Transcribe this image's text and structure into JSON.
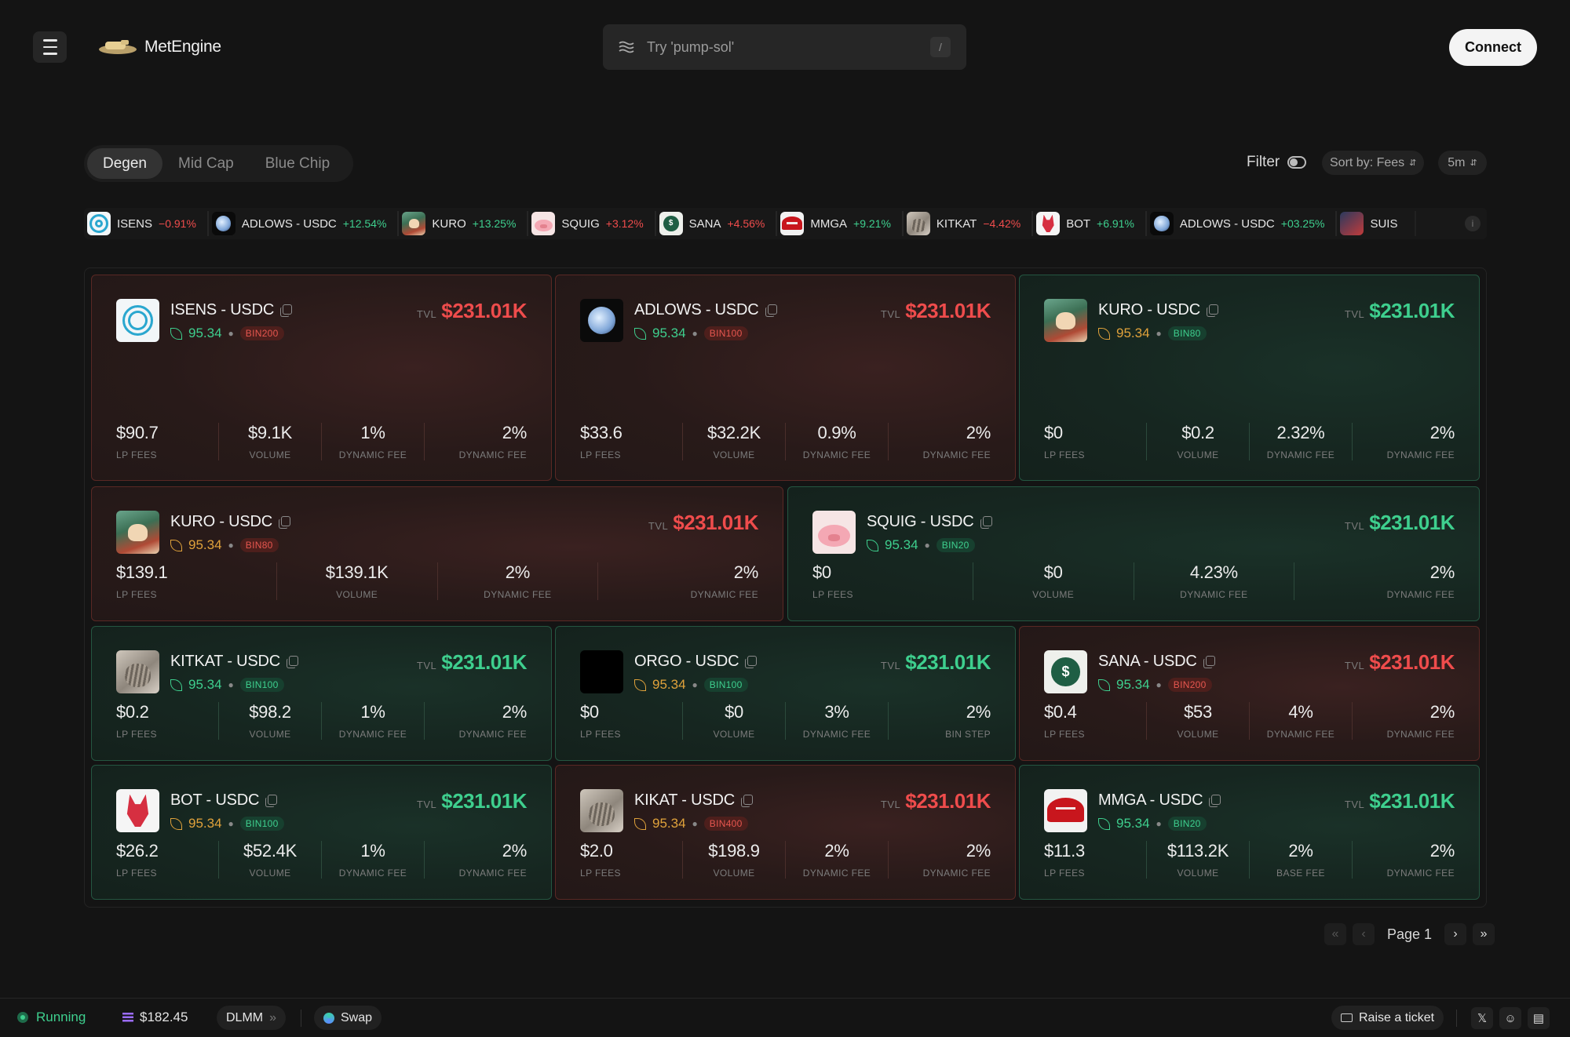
{
  "header": {
    "logo_text": "MetEngine",
    "search_placeholder": "Try 'pump-sol'",
    "search_shortcut": "/",
    "connect_label": "Connect"
  },
  "tabs": [
    {
      "label": "Degen",
      "active": true
    },
    {
      "label": "Mid Cap",
      "active": false
    },
    {
      "label": "Blue Chip",
      "active": false
    }
  ],
  "controls": {
    "filter_label": "Filter",
    "sort_label": "Sort by: Fees",
    "timeframe": "5m"
  },
  "ticker": [
    {
      "name": "ISENS",
      "change": "−0.91%",
      "dir": "down",
      "icon": "isens"
    },
    {
      "name": "ADLOWS - USDC",
      "change": "+12.54%",
      "dir": "up",
      "icon": "adlows"
    },
    {
      "name": "KURO",
      "change": "+13.25%",
      "dir": "up",
      "icon": "kuro"
    },
    {
      "name": "SQUIG",
      "change": "+3.12%",
      "dir": "down",
      "icon": "squig"
    },
    {
      "name": "SANA",
      "change": "+4.56%",
      "dir": "down",
      "icon": "sana"
    },
    {
      "name": "MMGA",
      "change": "+9.21%",
      "dir": "up",
      "icon": "mmga"
    },
    {
      "name": "KITKAT",
      "change": "−4.42%",
      "dir": "down",
      "icon": "kitkat"
    },
    {
      "name": "BOT",
      "change": "+6.91%",
      "dir": "up",
      "icon": "bot"
    },
    {
      "name": "ADLOWS - USDC",
      "change": "+03.25%",
      "dir": "up",
      "icon": "adlows"
    },
    {
      "name": "SUIS",
      "change": "",
      "dir": "up",
      "icon": "suis"
    }
  ],
  "tvl_label": "TVL",
  "cards": [
    {
      "pair": "ISENS - USDC",
      "icon": "isens",
      "theme": "red",
      "score": "95.34",
      "score_color": "green",
      "bin": "BIN200",
      "tvl": "$231.01K",
      "stats": [
        {
          "value": "$90.7",
          "label": "LP FEES"
        },
        {
          "value": "$9.1K",
          "label": "VOLUME"
        },
        {
          "value": "1%",
          "label": "DYNAMIC FEE"
        },
        {
          "value": "2%",
          "label": "DYNAMIC FEE"
        }
      ]
    },
    {
      "pair": "ADLOWS - USDC",
      "icon": "adlows",
      "theme": "red",
      "score": "95.34",
      "score_color": "green",
      "bin": "BIN100",
      "tvl": "$231.01K",
      "stats": [
        {
          "value": "$33.6",
          "label": "LP FEES"
        },
        {
          "value": "$32.2K",
          "label": "VOLUME"
        },
        {
          "value": "0.9%",
          "label": "DYNAMIC FEE"
        },
        {
          "value": "2%",
          "label": "DYNAMIC FEE"
        }
      ]
    },
    {
      "pair": "KURO - USDC",
      "icon": "kuro",
      "theme": "green",
      "score": "95.34",
      "score_color": "orange",
      "bin": "BIN80",
      "tvl": "$231.01K",
      "stats": [
        {
          "value": "$0",
          "label": "LP FEES"
        },
        {
          "value": "$0.2",
          "label": "VOLUME"
        },
        {
          "value": "2.32%",
          "label": "DYNAMIC FEE"
        },
        {
          "value": "2%",
          "label": "DYNAMIC FEE"
        }
      ]
    },
    {
      "pair": "KURO - USDC",
      "icon": "kuro",
      "theme": "red",
      "score": "95.34",
      "score_color": "orange",
      "bin": "BIN80",
      "tvl": "$231.01K",
      "stats": [
        {
          "value": "$139.1",
          "label": "LP FEES"
        },
        {
          "value": "$139.1K",
          "label": "VOLUME"
        },
        {
          "value": "2%",
          "label": "DYNAMIC FEE"
        },
        {
          "value": "2%",
          "label": "DYNAMIC FEE"
        }
      ]
    },
    {
      "pair": "SQUIG - USDC",
      "icon": "squig",
      "theme": "green",
      "score": "95.34",
      "score_color": "green",
      "bin": "BIN20",
      "tvl": "$231.01K",
      "stats": [
        {
          "value": "$0",
          "label": "LP FEES"
        },
        {
          "value": "$0",
          "label": "VOLUME"
        },
        {
          "value": "4.23%",
          "label": "DYNAMIC FEE"
        },
        {
          "value": "2%",
          "label": "DYNAMIC FEE"
        }
      ]
    },
    {
      "pair": "KITKAT - USDC",
      "icon": "kitkat",
      "theme": "green",
      "score": "95.34",
      "score_color": "green",
      "bin": "BIN100",
      "tvl": "$231.01K",
      "stats": [
        {
          "value": "$0.2",
          "label": "LP FEES"
        },
        {
          "value": "$98.2",
          "label": "VOLUME"
        },
        {
          "value": "1%",
          "label": "DYNAMIC FEE"
        },
        {
          "value": "2%",
          "label": "DYNAMIC FEE"
        }
      ]
    },
    {
      "pair": "ORGO - USDC",
      "icon": "orgo",
      "theme": "green",
      "score": "95.34",
      "score_color": "orange",
      "bin": "BIN100",
      "tvl": "$231.01K",
      "stats": [
        {
          "value": "$0",
          "label": "LP FEES"
        },
        {
          "value": "$0",
          "label": "VOLUME"
        },
        {
          "value": "3%",
          "label": "DYNAMIC FEE"
        },
        {
          "value": "2%",
          "label": "BIN STEP"
        }
      ]
    },
    {
      "pair": "SANA - USDC",
      "icon": "sana",
      "theme": "red",
      "score": "95.34",
      "score_color": "green",
      "bin": "BIN200",
      "tvl": "$231.01K",
      "stats": [
        {
          "value": "$0.4",
          "label": "LP FEES"
        },
        {
          "value": "$53",
          "label": "VOLUME"
        },
        {
          "value": "4%",
          "label": "DYNAMIC FEE"
        },
        {
          "value": "2%",
          "label": "DYNAMIC FEE"
        }
      ]
    },
    {
      "pair": "BOT - USDC",
      "icon": "bot",
      "theme": "green",
      "score": "95.34",
      "score_color": "orange",
      "bin": "BIN100",
      "tvl": "$231.01K",
      "stats": [
        {
          "value": "$26.2",
          "label": "LP FEES"
        },
        {
          "value": "$52.4K",
          "label": "VOLUME"
        },
        {
          "value": "1%",
          "label": "DYNAMIC FEE"
        },
        {
          "value": "2%",
          "label": "DYNAMIC FEE"
        }
      ]
    },
    {
      "pair": "KIKAT - USDC",
      "icon": "kitkat",
      "theme": "red",
      "score": "95.34",
      "score_color": "orange",
      "bin": "BIN400",
      "tvl": "$231.01K",
      "stats": [
        {
          "value": "$2.0",
          "label": "LP FEES"
        },
        {
          "value": "$198.9",
          "label": "VOLUME"
        },
        {
          "value": "2%",
          "label": "DYNAMIC FEE"
        },
        {
          "value": "2%",
          "label": "DYNAMIC FEE"
        }
      ]
    },
    {
      "pair": "MMGA - USDC",
      "icon": "mmga",
      "theme": "green",
      "score": "95.34",
      "score_color": "green",
      "bin": "BIN20",
      "tvl": "$231.01K",
      "stats": [
        {
          "value": "$11.3",
          "label": "LP FEES"
        },
        {
          "value": "$113.2K",
          "label": "VOLUME"
        },
        {
          "value": "2%",
          "label": "BASE FEE"
        },
        {
          "value": "2%",
          "label": "DYNAMIC FEE"
        }
      ]
    }
  ],
  "pagination": {
    "label": "Page 1"
  },
  "footer": {
    "status": "Running",
    "sol_price": "$182.45",
    "dlmm_label": "DLMM",
    "swap_label": "Swap",
    "ticket_label": "Raise a ticket"
  }
}
